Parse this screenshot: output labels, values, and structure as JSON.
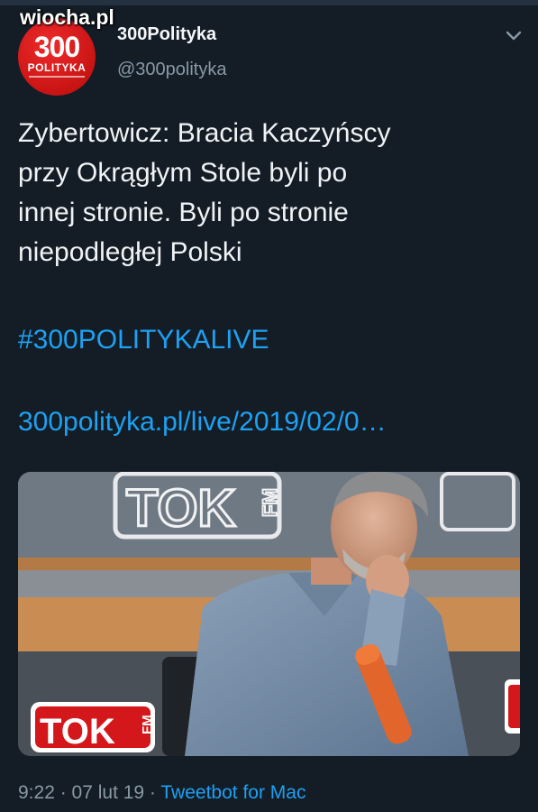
{
  "watermark": "wiocha.pl",
  "profile": {
    "avatar_big": "300",
    "avatar_small": "POLITYKA",
    "display_name": "300Polityka",
    "handle": "@300polityka"
  },
  "tweet": {
    "text_lines": [
      "Zybertowicz: Bracia Kaczyńscy",
      "przy Okrągłym Stole byli po",
      "innej stronie. Byli po stronie",
      "niepodległej Polski"
    ],
    "hashtag": "#300POLITYKALIVE",
    "link": "300polityka.pl/live/2019/02/0…"
  },
  "media": {
    "backdrop_logo": "TOK",
    "backdrop_fm": "FM",
    "badge_logo": "TOK",
    "badge_fm": "FM"
  },
  "meta": {
    "timestamp": "9:22 · 07 lut 19 · ",
    "client": "Tweetbot for Mac"
  },
  "colors": {
    "background": "#141d26",
    "accent": "#1da1f2",
    "muted": "#8899a6",
    "brand_red": "#d3171a"
  },
  "icons": {
    "menu": "chevron-down-icon"
  }
}
